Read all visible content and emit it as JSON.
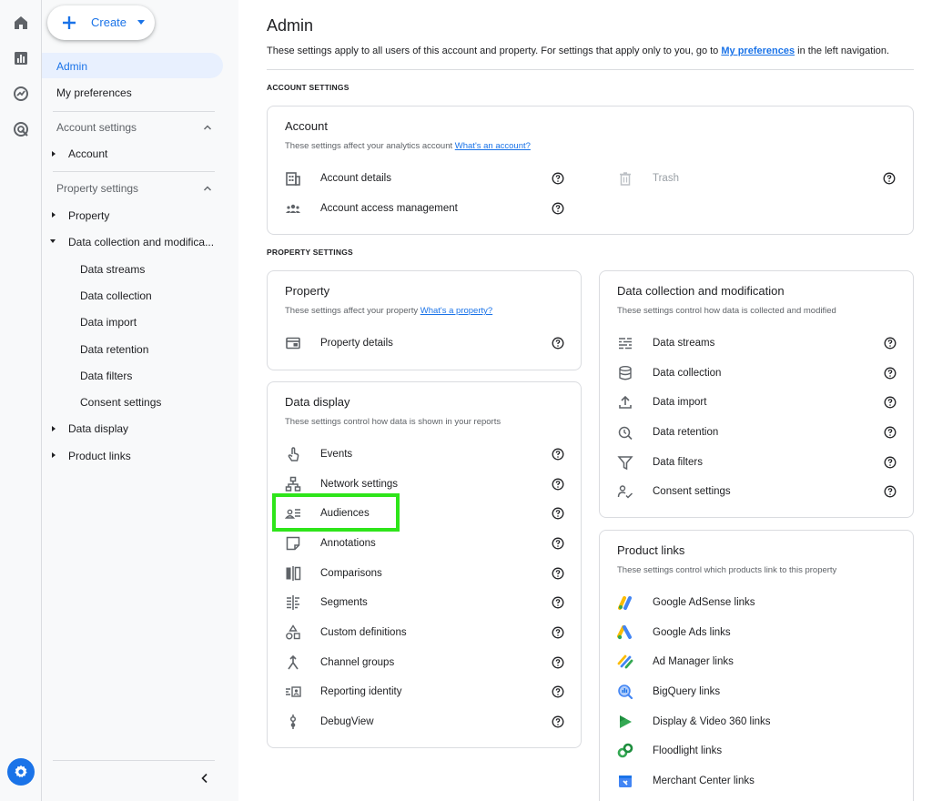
{
  "nav": {
    "create_label": "Create",
    "admin": "Admin",
    "my_preferences": "My preferences",
    "account_settings": "Account settings",
    "account": "Account",
    "property_settings": "Property settings",
    "property": "Property",
    "data_collection_mod": "Data collection and modifica...",
    "data_streams": "Data streams",
    "data_collection": "Data collection",
    "data_import": "Data import",
    "data_retention": "Data retention",
    "data_filters": "Data filters",
    "consent_settings": "Consent settings",
    "data_display": "Data display",
    "product_links": "Product links"
  },
  "page": {
    "title": "Admin",
    "desc_before": "These settings apply to all users of this account and property. For settings that apply only to you, go to ",
    "desc_link": "My preferences",
    "desc_after": " in the left navigation.",
    "account_settings_label": "ACCOUNT SETTINGS",
    "property_settings_label": "PROPERTY SETTINGS"
  },
  "account_card": {
    "title": "Account",
    "sub": "These settings affect your analytics account ",
    "sub_link": "What's an account?",
    "items": [
      "Account details",
      "Account access management",
      "Trash"
    ]
  },
  "property_card": {
    "title": "Property",
    "sub": "These settings affect your property ",
    "sub_link": "What's a property?",
    "items": [
      "Property details"
    ]
  },
  "data_display_card": {
    "title": "Data display",
    "sub": "These settings control how data is shown in your reports",
    "items": [
      "Events",
      "Network settings",
      "Audiences",
      "Annotations",
      "Comparisons",
      "Segments",
      "Custom definitions",
      "Channel groups",
      "Reporting identity",
      "DebugView"
    ]
  },
  "data_collection_card": {
    "title": "Data collection and modification",
    "sub": "These settings control how data is collected and modified",
    "items": [
      "Data streams",
      "Data collection",
      "Data import",
      "Data retention",
      "Data filters",
      "Consent settings"
    ]
  },
  "product_links_card": {
    "title": "Product links",
    "sub": "These settings control which products link to this property",
    "items": [
      "Google AdSense links",
      "Google Ads links",
      "Ad Manager links",
      "BigQuery links",
      "Display & Video 360 links",
      "Floodlight links",
      "Merchant Center links"
    ]
  },
  "colors": {
    "accent": "#1a73e8",
    "highlight": "#2ee51a",
    "icon_gray": "#5f6368"
  }
}
